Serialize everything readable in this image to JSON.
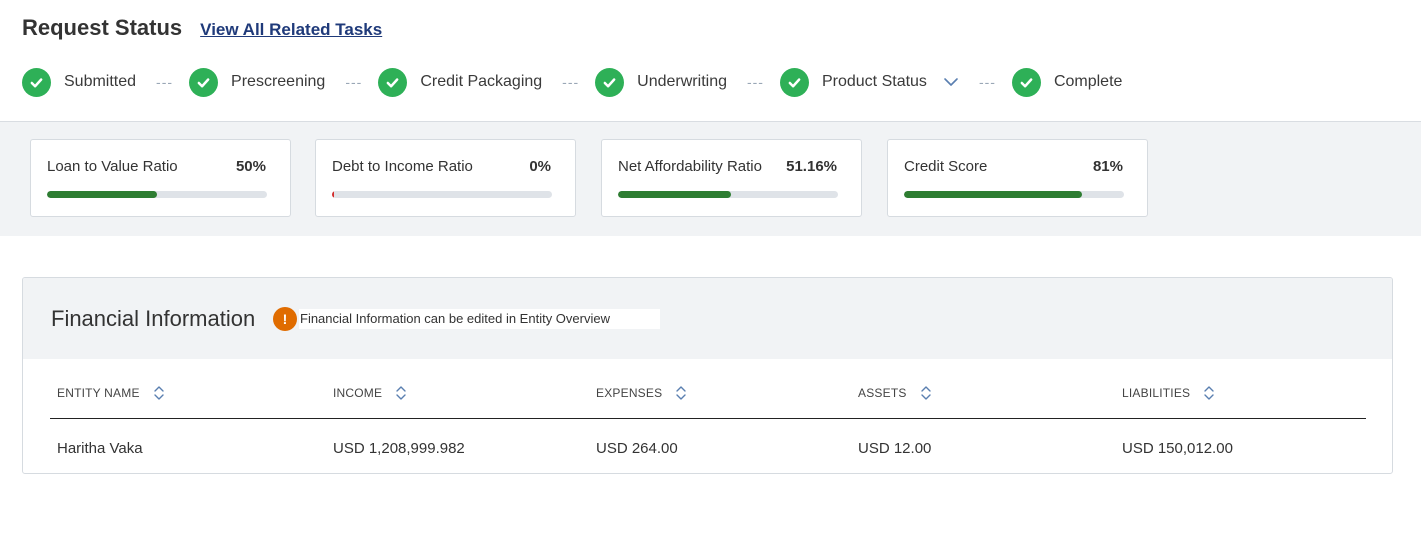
{
  "header": {
    "title": "Request Status",
    "tasks_link": "View All Related Tasks"
  },
  "steps": [
    {
      "label": "Submitted",
      "status": "complete"
    },
    {
      "label": "Prescreening",
      "status": "complete"
    },
    {
      "label": "Credit Packaging",
      "status": "complete"
    },
    {
      "label": "Underwriting",
      "status": "complete"
    },
    {
      "label": "Product Status",
      "status": "complete"
    },
    {
      "label": "Complete",
      "status": "complete"
    }
  ],
  "step_separator": "---",
  "metrics": [
    {
      "label": "Loan to Value Ratio",
      "value": "50%",
      "fill_percent": 50,
      "color": "#2e7d32"
    },
    {
      "label": "Debt to Income Ratio",
      "value": "0%",
      "fill_percent": 0,
      "color": "#d32f2f"
    },
    {
      "label": "Net Affordability Ratio",
      "value": "51.16%",
      "fill_percent": 51.16,
      "color": "#2e7d32"
    },
    {
      "label": "Credit Score",
      "value": "81%",
      "fill_percent": 81,
      "color": "#2e7d32"
    }
  ],
  "financial": {
    "title": "Financial Information",
    "note": "Financial Information can be edited in Entity Overview",
    "columns": [
      "ENTITY NAME",
      "INCOME",
      "EXPENSES",
      "ASSETS",
      "LIABILITIES"
    ],
    "rows": [
      [
        "Haritha Vaka",
        "USD 1,208,999.982",
        "USD 264.00",
        "USD 12.00",
        "USD 150,012.00"
      ]
    ]
  },
  "colors": {
    "step_complete": "#2eb057",
    "link": "#1f3a7a",
    "warning": "#e06c00",
    "band": "#f1f3f5"
  },
  "icons": {
    "step": "check-circle-icon",
    "expand": "chevron-down-icon",
    "warning": "exclamation-icon",
    "sort": "sort-icon"
  }
}
